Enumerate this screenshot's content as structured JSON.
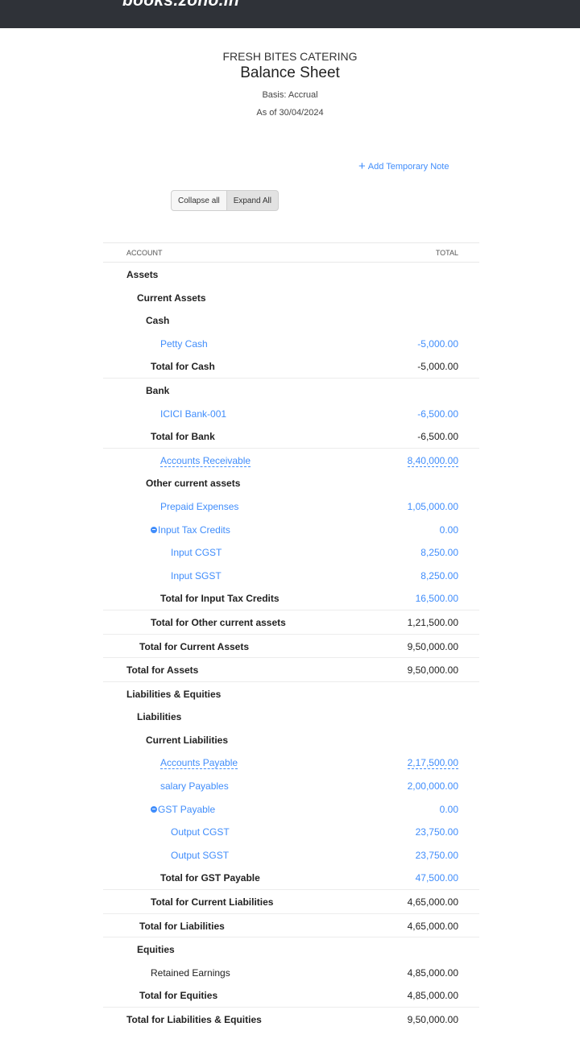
{
  "topbar": {
    "brand": "books.zoho.in"
  },
  "report": {
    "organization": "FRESH BITES CATERING",
    "title": "Balance Sheet",
    "basis": "Basis: Accrual",
    "as_of": "As of 30/04/2024"
  },
  "actions": {
    "add_note": "Add Temporary Note",
    "collapse_all": "Collapse all",
    "expand_all": "Expand All"
  },
  "table": {
    "headers": {
      "account": "ACCOUNT",
      "total": "TOTAL"
    },
    "rows": [
      {
        "name": "Assets",
        "amount": "",
        "level": 0,
        "style": "bold"
      },
      {
        "name": "Current Assets",
        "amount": "",
        "level": 1,
        "style": "bold"
      },
      {
        "name": "Cash",
        "amount": "",
        "level": 2,
        "style": "bold"
      },
      {
        "name": "Petty Cash",
        "amount": "-5,000.00",
        "level": 4,
        "style": "link"
      },
      {
        "name": "Total for Cash",
        "amount": "-5,000.00",
        "level": 3,
        "style": "bold",
        "amount_style": "plain"
      },
      {
        "name": "Bank",
        "amount": "",
        "level": 2,
        "style": "bold",
        "line": true
      },
      {
        "name": "ICICI Bank-001",
        "amount": "-6,500.00",
        "level": 4,
        "style": "link"
      },
      {
        "name": "Total for Bank",
        "amount": "-6,500.00",
        "level": 3,
        "style": "bold",
        "amount_style": "plain"
      },
      {
        "name": "Accounts Receivable",
        "amount": "8,40,000.00",
        "level": 4,
        "style": "link-dashed",
        "line": true
      },
      {
        "name": "Other current assets",
        "amount": "",
        "level": 2,
        "style": "bold"
      },
      {
        "name": "Prepaid Expenses",
        "amount": "1,05,000.00",
        "level": 4,
        "style": "link"
      },
      {
        "name": "Input Tax Credits",
        "amount": "0.00",
        "level": 3,
        "style": "link-collapse"
      },
      {
        "name": "Input CGST",
        "amount": "8,250.00",
        "level": 5,
        "style": "link"
      },
      {
        "name": "Input SGST",
        "amount": "8,250.00",
        "level": 5,
        "style": "link"
      },
      {
        "name": "Total for Input Tax Credits",
        "amount": "16,500.00",
        "level": 4,
        "style": "bold",
        "amount_style": "link"
      },
      {
        "name": "Total for Other current assets",
        "amount": "1,21,500.00",
        "level": 3,
        "style": "bold",
        "amount_style": "plain",
        "line": true
      },
      {
        "name": "Total for Current Assets",
        "amount": "9,50,000.00",
        "level": 1.5,
        "style": "bold",
        "amount_style": "plain",
        "line": true
      },
      {
        "name": "Total for Assets",
        "amount": "9,50,000.00",
        "level": 0,
        "style": "bold",
        "amount_style": "plain",
        "line": true
      },
      {
        "name": "Liabilities & Equities",
        "amount": "",
        "level": 0,
        "style": "bold",
        "line": true
      },
      {
        "name": "Liabilities",
        "amount": "",
        "level": 1,
        "style": "bold"
      },
      {
        "name": "Current Liabilities",
        "amount": "",
        "level": 2,
        "style": "bold"
      },
      {
        "name": "Accounts Payable",
        "amount": "2,17,500.00",
        "level": 4,
        "style": "link-dashed"
      },
      {
        "name": "salary Payables",
        "amount": "2,00,000.00",
        "level": 4,
        "style": "link"
      },
      {
        "name": "GST Payable",
        "amount": "0.00",
        "level": 3,
        "style": "link-collapse"
      },
      {
        "name": "Output CGST",
        "amount": "23,750.00",
        "level": 5,
        "style": "link"
      },
      {
        "name": "Output SGST",
        "amount": "23,750.00",
        "level": 5,
        "style": "link"
      },
      {
        "name": "Total for GST Payable",
        "amount": "47,500.00",
        "level": 4,
        "style": "bold",
        "amount_style": "link"
      },
      {
        "name": "Total for Current Liabilities",
        "amount": "4,65,000.00",
        "level": 3,
        "style": "bold",
        "amount_style": "plain",
        "line": true
      },
      {
        "name": "Total for Liabilities",
        "amount": "4,65,000.00",
        "level": 1.5,
        "style": "bold",
        "amount_style": "plain",
        "line": true
      },
      {
        "name": "Equities",
        "amount": "",
        "level": 1,
        "style": "bold",
        "line": true
      },
      {
        "name": "Retained Earnings",
        "amount": "4,85,000.00",
        "level": 3,
        "style": "plain",
        "amount_style": "plain"
      },
      {
        "name": "Total for Equities",
        "amount": "4,85,000.00",
        "level": 1.5,
        "style": "bold",
        "amount_style": "plain"
      },
      {
        "name": "Total for Liabilities & Equities",
        "amount": "9,50,000.00",
        "level": 0,
        "style": "bold",
        "amount_style": "plain",
        "line": true
      }
    ]
  },
  "colors": {
    "link": "#408dfb",
    "topbar": "#2f3238"
  }
}
